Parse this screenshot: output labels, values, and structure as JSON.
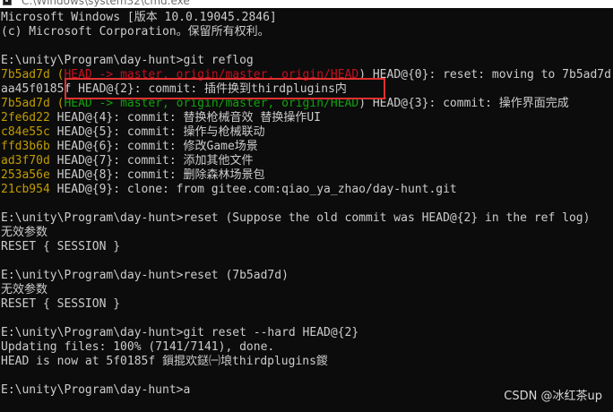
{
  "window": {
    "title": "C:\\Windows\\system32\\cmd.exe"
  },
  "colors": {
    "background": "#0c0c0c",
    "text": "#cccccc",
    "hash": "#c19c00",
    "head_ref": "#3a96dd",
    "branch": "#13a10e",
    "branch_dim": "#c50f1f",
    "highlight_box": "#e03030"
  },
  "console": {
    "header": [
      "Microsoft Windows [版本 10.0.19045.2846]",
      "(c) Microsoft Corporation。保留所有权利。"
    ],
    "prompt1": "E:\\unity\\Program\\day-hunt>git reflog",
    "reflog": [
      {
        "hash": "7b5ad7d",
        "pre": " (",
        "ref": "HEAD -> master, origin/master, origin/HEAD",
        "post": ") HEAD@{0}: reset: moving to 7b5ad7d"
      },
      {
        "hash": "aa45f0185f",
        "pre": " ",
        "ref": "",
        "post": "HEAD@{2}: commit: 插件换到thirdplugins内"
      },
      {
        "hash": "7b5ad7d",
        "pre": " (",
        "ref": "HEAD -> master, origin/master, origin/HEAD",
        "post": ") HEAD@{3}: commit: 操作界面完成"
      },
      {
        "hash": "2fe6d22",
        "pre": " ",
        "ref": "",
        "post": "HEAD@{4}: commit: 替换枪械音效 替换操作UI"
      },
      {
        "hash": "c84e55c",
        "pre": " ",
        "ref": "",
        "post": "HEAD@{5}: commit: 操作与枪械联动"
      },
      {
        "hash": "ffd3b6b",
        "pre": " ",
        "ref": "",
        "post": "HEAD@{6}: commit: 修改Game场景"
      },
      {
        "hash": "ad3f70d",
        "pre": " ",
        "ref": "",
        "post": "HEAD@{7}: commit: 添加其他文件"
      },
      {
        "hash": "253a56e",
        "pre": " ",
        "ref": "",
        "post": "HEAD@{8}: commit: 删除森林场景包"
      },
      {
        "hash": "21cb954",
        "pre": " ",
        "ref": "",
        "post": "HEAD@{9}: clone: from gitee.com:qiao_ya_zhao/day-hunt.git"
      }
    ],
    "prompt2": "E:\\unity\\Program\\day-hunt>reset (Suppose the old commit was HEAD@{2} in the ref log)",
    "invalid1": "无效参数",
    "session1": "RESET { SESSION }",
    "prompt3": "E:\\unity\\Program\\day-hunt>reset (7b5ad7d)",
    "invalid2": "无效参数",
    "session2": "RESET { SESSION }",
    "prompt4": "E:\\unity\\Program\\day-hunt>git reset --hard HEAD@{2}",
    "updating": "Updating files: 100% (7141/7141), done.",
    "head_now": "HEAD is now at 5f0185f 鎻掍欢鎹㈠埌thirdplugins鍐",
    "prompt5": "E:\\unity\\Program\\day-hunt>a"
  },
  "watermark": "CSDN @冰红茶up"
}
